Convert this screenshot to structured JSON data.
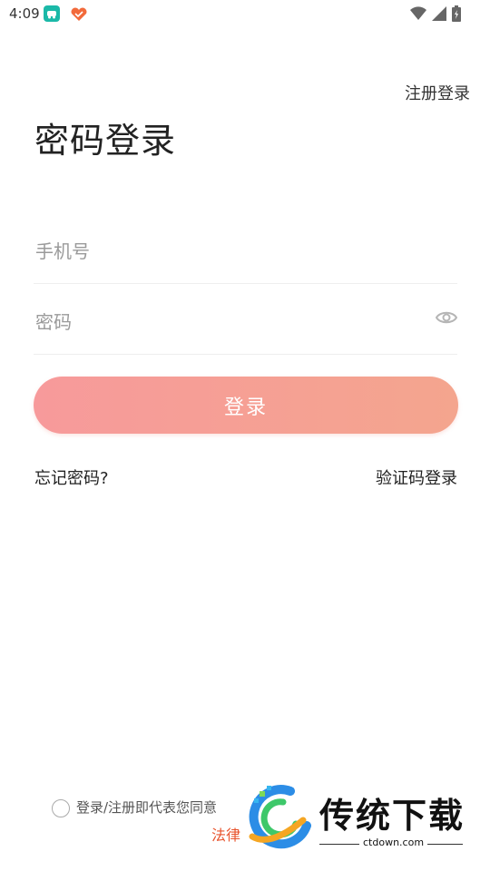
{
  "status_bar": {
    "time": "4:09"
  },
  "header": {
    "register_login": "注册登录",
    "title": "密码登录"
  },
  "form": {
    "phone_placeholder": "手机号",
    "password_placeholder": "密码",
    "login_button": "登录"
  },
  "links": {
    "forgot_password": "忘记密码?",
    "code_login": "验证码登录"
  },
  "agreement": {
    "text": "登录/注册即代表您同意",
    "link_partial": "法律"
  },
  "watermark": {
    "brand": "传统下载",
    "url": "ctdown.com"
  },
  "icons": [
    "teal-app-icon",
    "heart-app-icon",
    "wifi-icon",
    "signal-icon",
    "battery-icon",
    "eye-icon"
  ],
  "colors": {
    "button_start": "#f79a9b",
    "button_end": "#f4a58e",
    "link_accent": "#e8532c"
  }
}
